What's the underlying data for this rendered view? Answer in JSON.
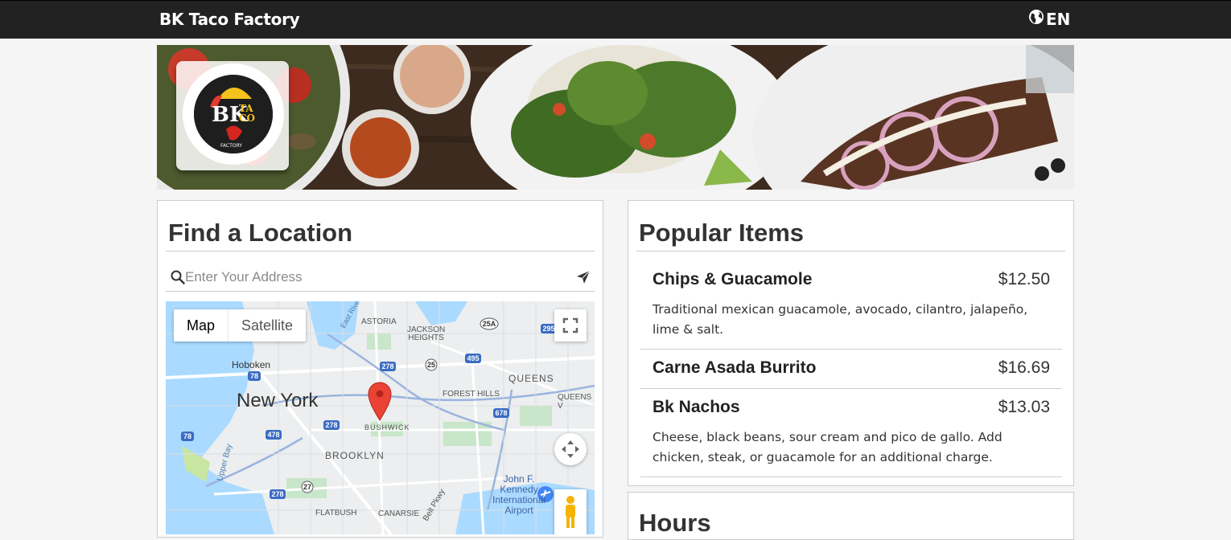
{
  "header": {
    "brand": "BK Taco Factory",
    "language": "EN",
    "globe_icon": "globe-icon"
  },
  "hero": {
    "logo_alt": "BK Taco Factory logo",
    "logo_text_bk": "BK",
    "logo_text_ta": "TA",
    "logo_text_co": "CO",
    "logo_text_factory": "FACTORY"
  },
  "location": {
    "title": "Find a Location",
    "search_placeholder": "Enter Your Address",
    "search_value": "",
    "map": {
      "type_map": "Map",
      "type_satellite": "Satellite",
      "labels": {
        "new_york": "New York",
        "brooklyn": "BROOKLYN",
        "queens": "QUEENS",
        "hoboken": "Hoboken",
        "astoria": "ASTORIA",
        "jackson_heights": "JACKSON\nHEIGHTS",
        "forest_hills": "FOREST HILLS",
        "bushwick": "BUSHWICK",
        "flatbush": "FLATBUSH",
        "canarsie": "CANARSIE",
        "queens_v": "QUEENS V",
        "upper_bay": "Upper Bay",
        "east_river": "East River",
        "jfk": "John F.\nKennedy\nInternational\nAirport",
        "belt_pkwy": "Belt Pkwy"
      },
      "shields": [
        "78",
        "278",
        "495",
        "25",
        "25A",
        "295",
        "478",
        "278",
        "678",
        "27",
        "278",
        "78"
      ]
    }
  },
  "popular": {
    "title": "Popular Items",
    "items": [
      {
        "name": "Chips & Guacamole",
        "price": "$12.50",
        "description": "Traditional mexican guacamole, avocado, cilantro, jalapeño, lime & salt."
      },
      {
        "name": "Carne Asada Burrito",
        "price": "$16.69",
        "description": ""
      },
      {
        "name": "Bk Nachos",
        "price": "$13.03",
        "description": "Cheese, black beans, sour cream and pico de gallo. Add chicken, steak, or guacamole for an additional charge."
      }
    ]
  },
  "hours": {
    "title": "Hours"
  }
}
